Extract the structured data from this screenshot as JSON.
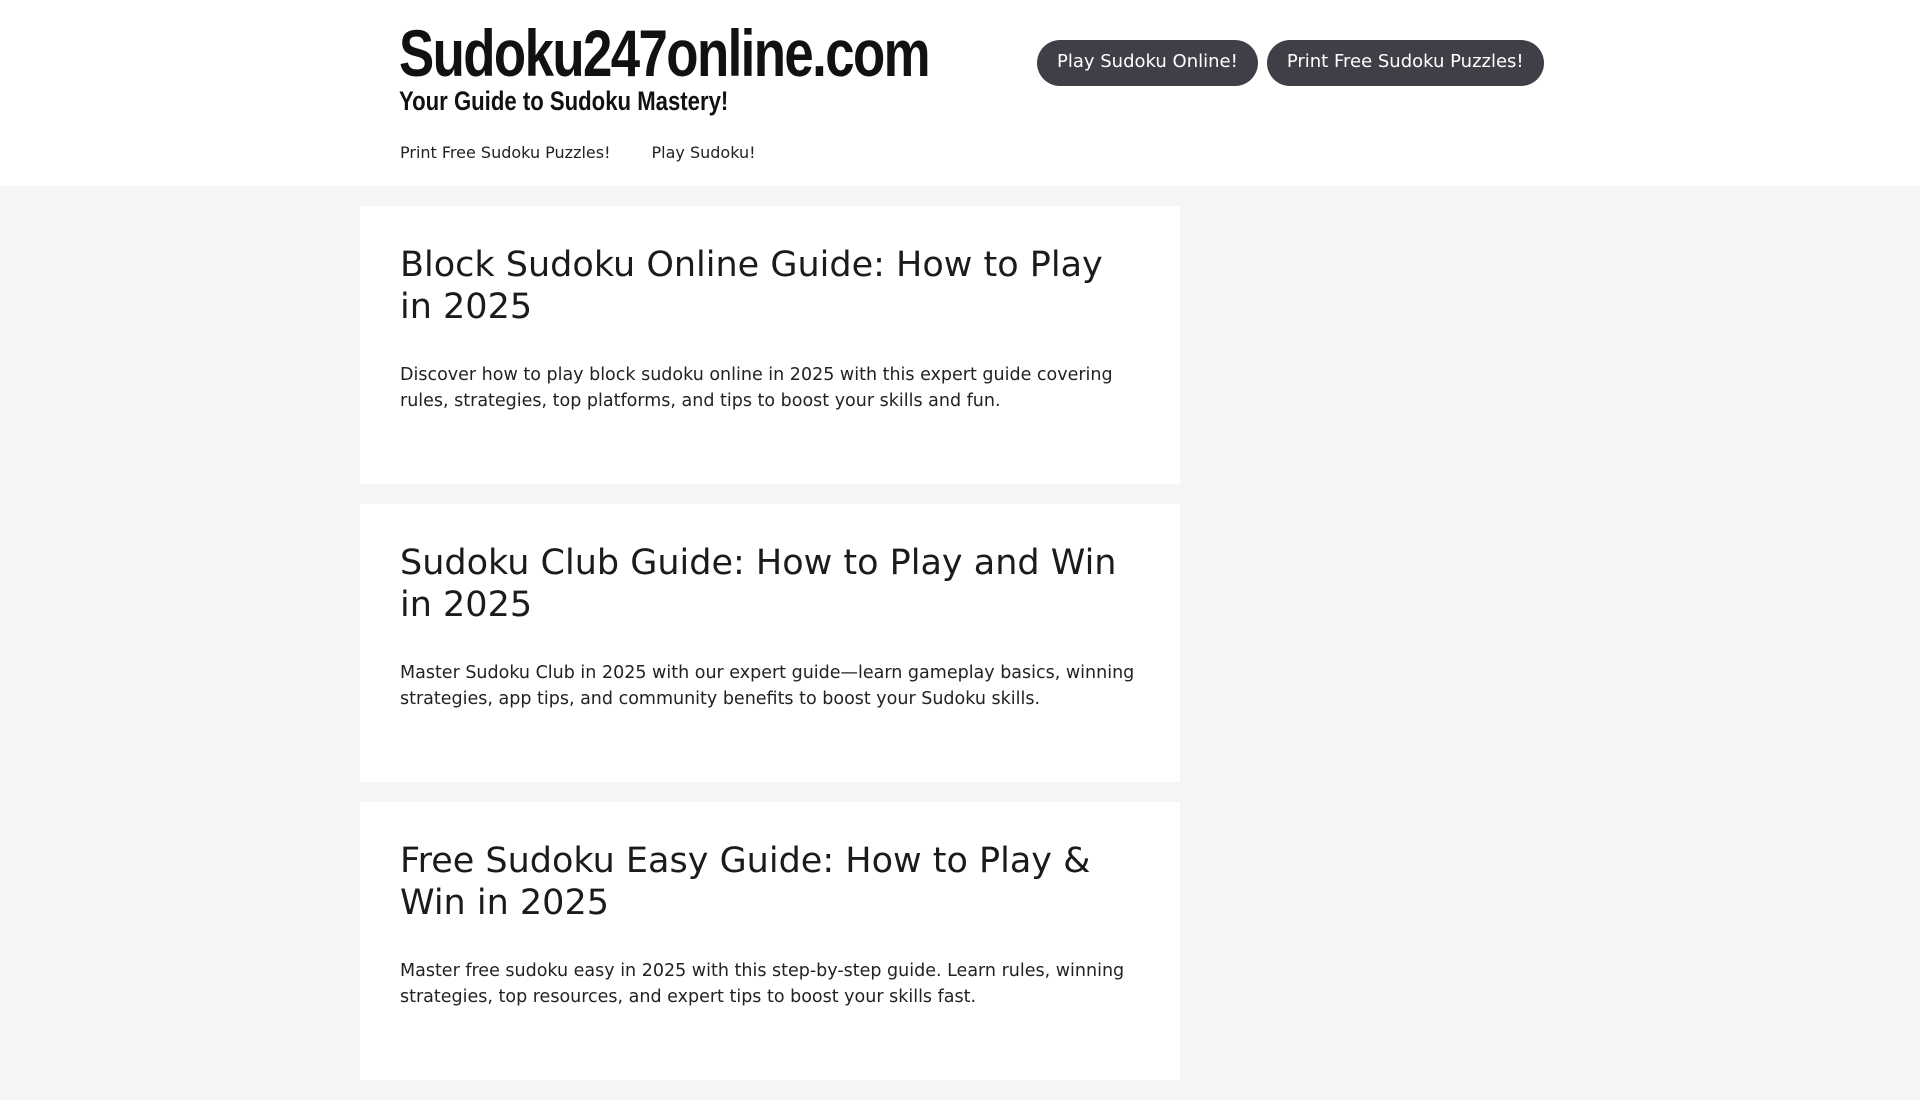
{
  "site": {
    "title": "Sudoku247online.com",
    "tagline": "Your Guide to Sudoku Mastery!"
  },
  "header_buttons": [
    {
      "label": "Play Sudoku Online!"
    },
    {
      "label": "Print Free Sudoku Puzzles!"
    }
  ],
  "nav": {
    "items": [
      {
        "label": "Print Free Sudoku Puzzles!"
      },
      {
        "label": "Play Sudoku!"
      }
    ]
  },
  "posts": [
    {
      "title": "Block Sudoku Online Guide: How to Play in 2025",
      "excerpt": "Discover how to play block sudoku online in 2025 with this expert guide covering rules, strategies, top platforms, and tips to boost your skills and fun."
    },
    {
      "title": "Sudoku Club Guide: How to Play and Win in 2025",
      "excerpt": "Master Sudoku Club in 2025 with our expert guide—learn gameplay basics, winning strategies, app tips, and community benefits to boost your Sudoku skills."
    },
    {
      "title": "Free Sudoku Easy Guide: How to Play & Win in 2025",
      "excerpt": "Master free sudoku easy in 2025 with this step-by-step guide. Learn rules, winning strategies, top resources, and expert tips to boost your skills fast."
    }
  ],
  "colors": {
    "page_background": "#f4f5f7",
    "card_background": "#ffffff",
    "button_background": "#3f4047",
    "button_text": "#ffffff",
    "text": "#222222"
  }
}
